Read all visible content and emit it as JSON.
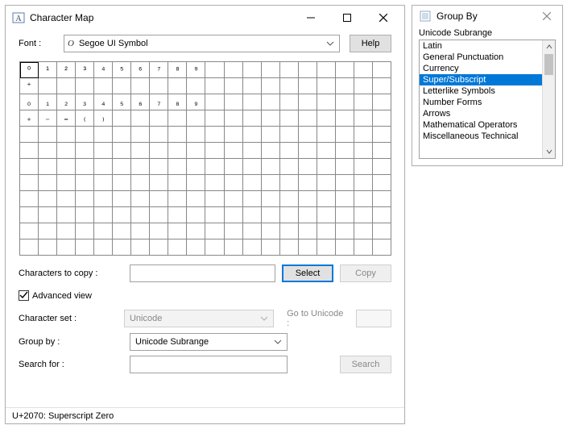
{
  "main": {
    "title": "Character Map",
    "font_label": "Font :",
    "font_selected": "Segoe UI Symbol",
    "help": "Help",
    "grid": {
      "cols": 20,
      "rows": 12,
      "selected_index": 0,
      "chars": [
        "⁰",
        "¹",
        "²",
        "³",
        "⁴",
        "⁵",
        "⁶",
        "⁷",
        "⁸",
        "⁹",
        "",
        "",
        "",
        "",
        "",
        "",
        "",
        "",
        "",
        "",
        "⁺",
        "",
        "",
        "",
        "",
        "",
        "",
        "",
        "",
        "",
        "",
        "",
        "",
        "",
        "",
        "",
        "",
        "",
        "",
        "",
        "₀",
        "₁",
        "₂",
        "₃",
        "₄",
        "₅",
        "₆",
        "₇",
        "₈",
        "₉",
        "",
        "",
        "",
        "",
        "",
        "",
        "",
        "",
        "",
        "",
        "₊",
        "₋",
        "₌",
        "₍",
        "₎"
      ]
    },
    "copy_label": "Characters to copy :",
    "copy_value": "",
    "select_btn": "Select",
    "copy_btn": "Copy",
    "advanced_checked": true,
    "advanced_label": "Advanced view",
    "charset_label": "Character set :",
    "charset_value": "Unicode",
    "goto_label": "Go to Unicode :",
    "goto_value": "",
    "groupby_label": "Group by :",
    "groupby_value": "Unicode Subrange",
    "search_label": "Search for :",
    "search_value": "",
    "search_btn": "Search",
    "status": "U+2070: Superscript Zero"
  },
  "group": {
    "title": "Group By",
    "heading": "Unicode Subrange",
    "selected_index": 3,
    "items": [
      "Latin",
      "General Punctuation",
      "Currency",
      "Super/Subscript",
      "Letterlike Symbols",
      "Number Forms",
      "Arrows",
      "Mathematical Operators",
      "Miscellaneous Technical"
    ]
  }
}
